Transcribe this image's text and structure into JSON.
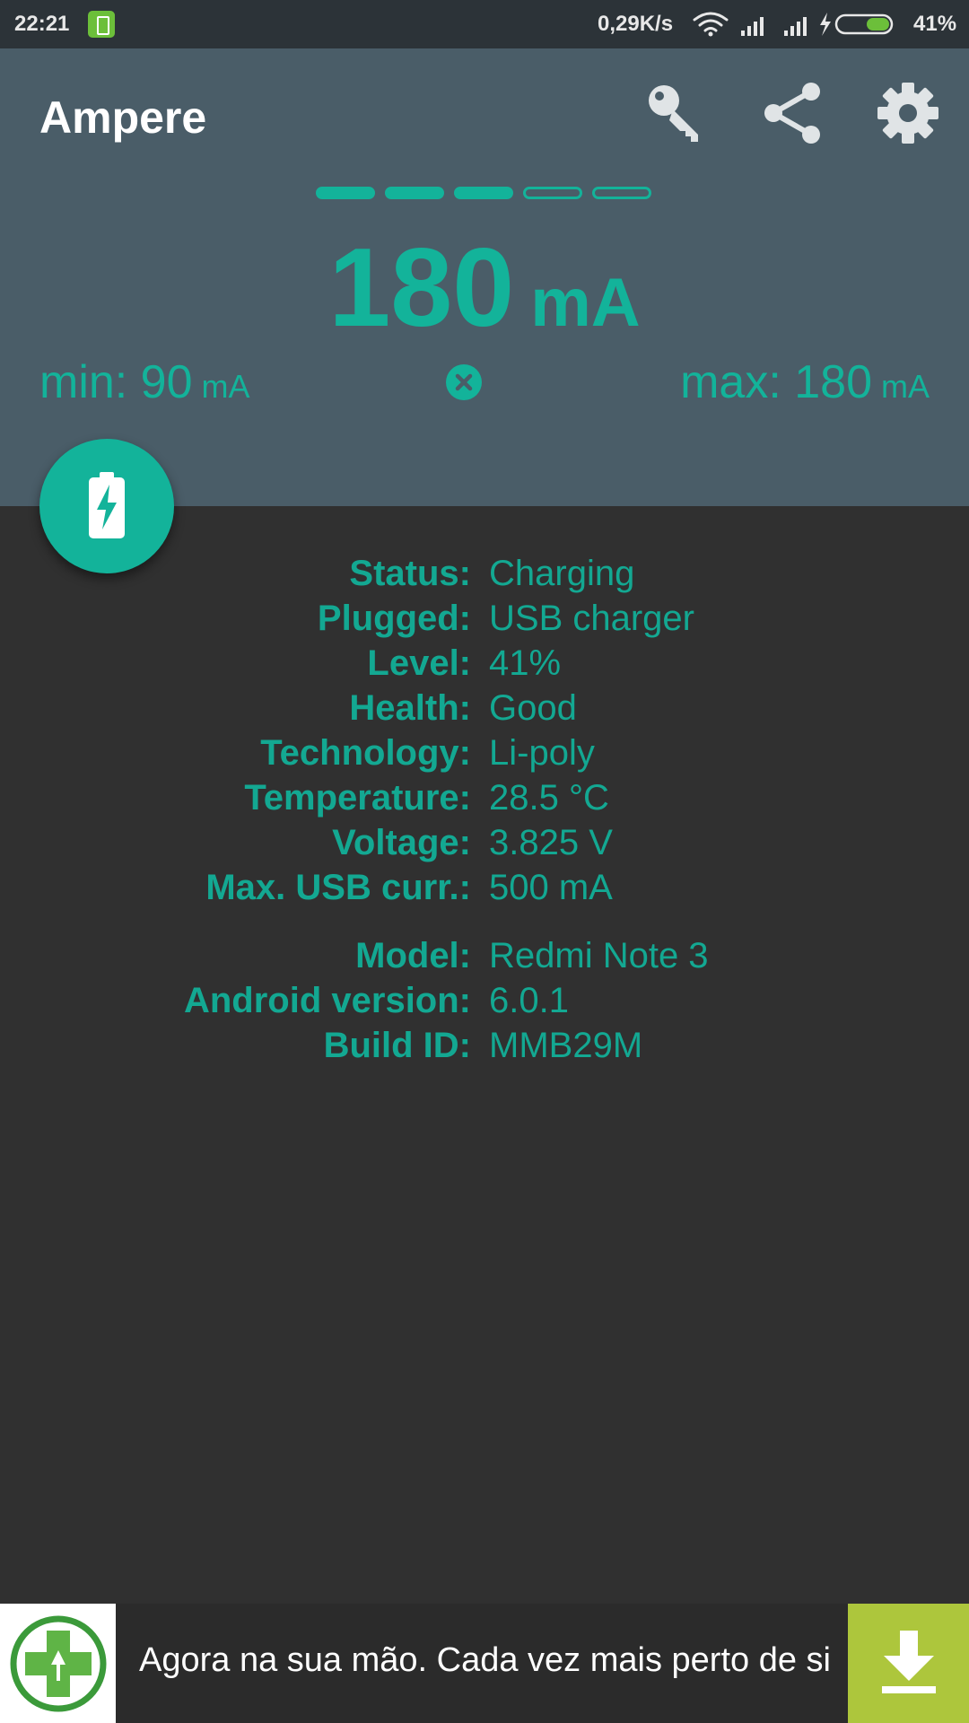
{
  "status_bar": {
    "time": "22:21",
    "net_speed": "0,29K/s",
    "battery_level": "41%"
  },
  "header": {
    "app_title": "Ampere",
    "level_segments": {
      "filled": 3,
      "total": 5
    },
    "current_value": "180",
    "current_unit": "mA",
    "min_label": "min: 90",
    "min_unit": "mA",
    "max_label": "max: 180",
    "max_unit": "mA",
    "icons": [
      "key-icon",
      "share-icon",
      "settings-icon",
      "reset-icon",
      "battery-charging-icon"
    ]
  },
  "info": {
    "battery": [
      {
        "label": "Status:",
        "value": "Charging"
      },
      {
        "label": "Plugged:",
        "value": "USB charger"
      },
      {
        "label": "Level:",
        "value": "41%"
      },
      {
        "label": "Health:",
        "value": "Good"
      },
      {
        "label": "Technology:",
        "value": "Li-poly"
      },
      {
        "label": "Temperature:",
        "value": "28.5 °C"
      },
      {
        "label": "Voltage:",
        "value": "3.825 V"
      },
      {
        "label": "Max. USB curr.:",
        "value": "500 mA"
      }
    ],
    "device": [
      {
        "label": "Model:",
        "value": "Redmi Note 3"
      },
      {
        "label": "Android version:",
        "value": "6.0.1"
      },
      {
        "label": "Build ID:",
        "value": "MMB29M"
      }
    ]
  },
  "ad": {
    "text": "Agora na sua mão. Cada vez mais perto de si"
  },
  "colors": {
    "accent": "#13b39a",
    "header_bg": "#4a5d68",
    "body_bg": "#303030",
    "ad_button": "#adc63c"
  }
}
